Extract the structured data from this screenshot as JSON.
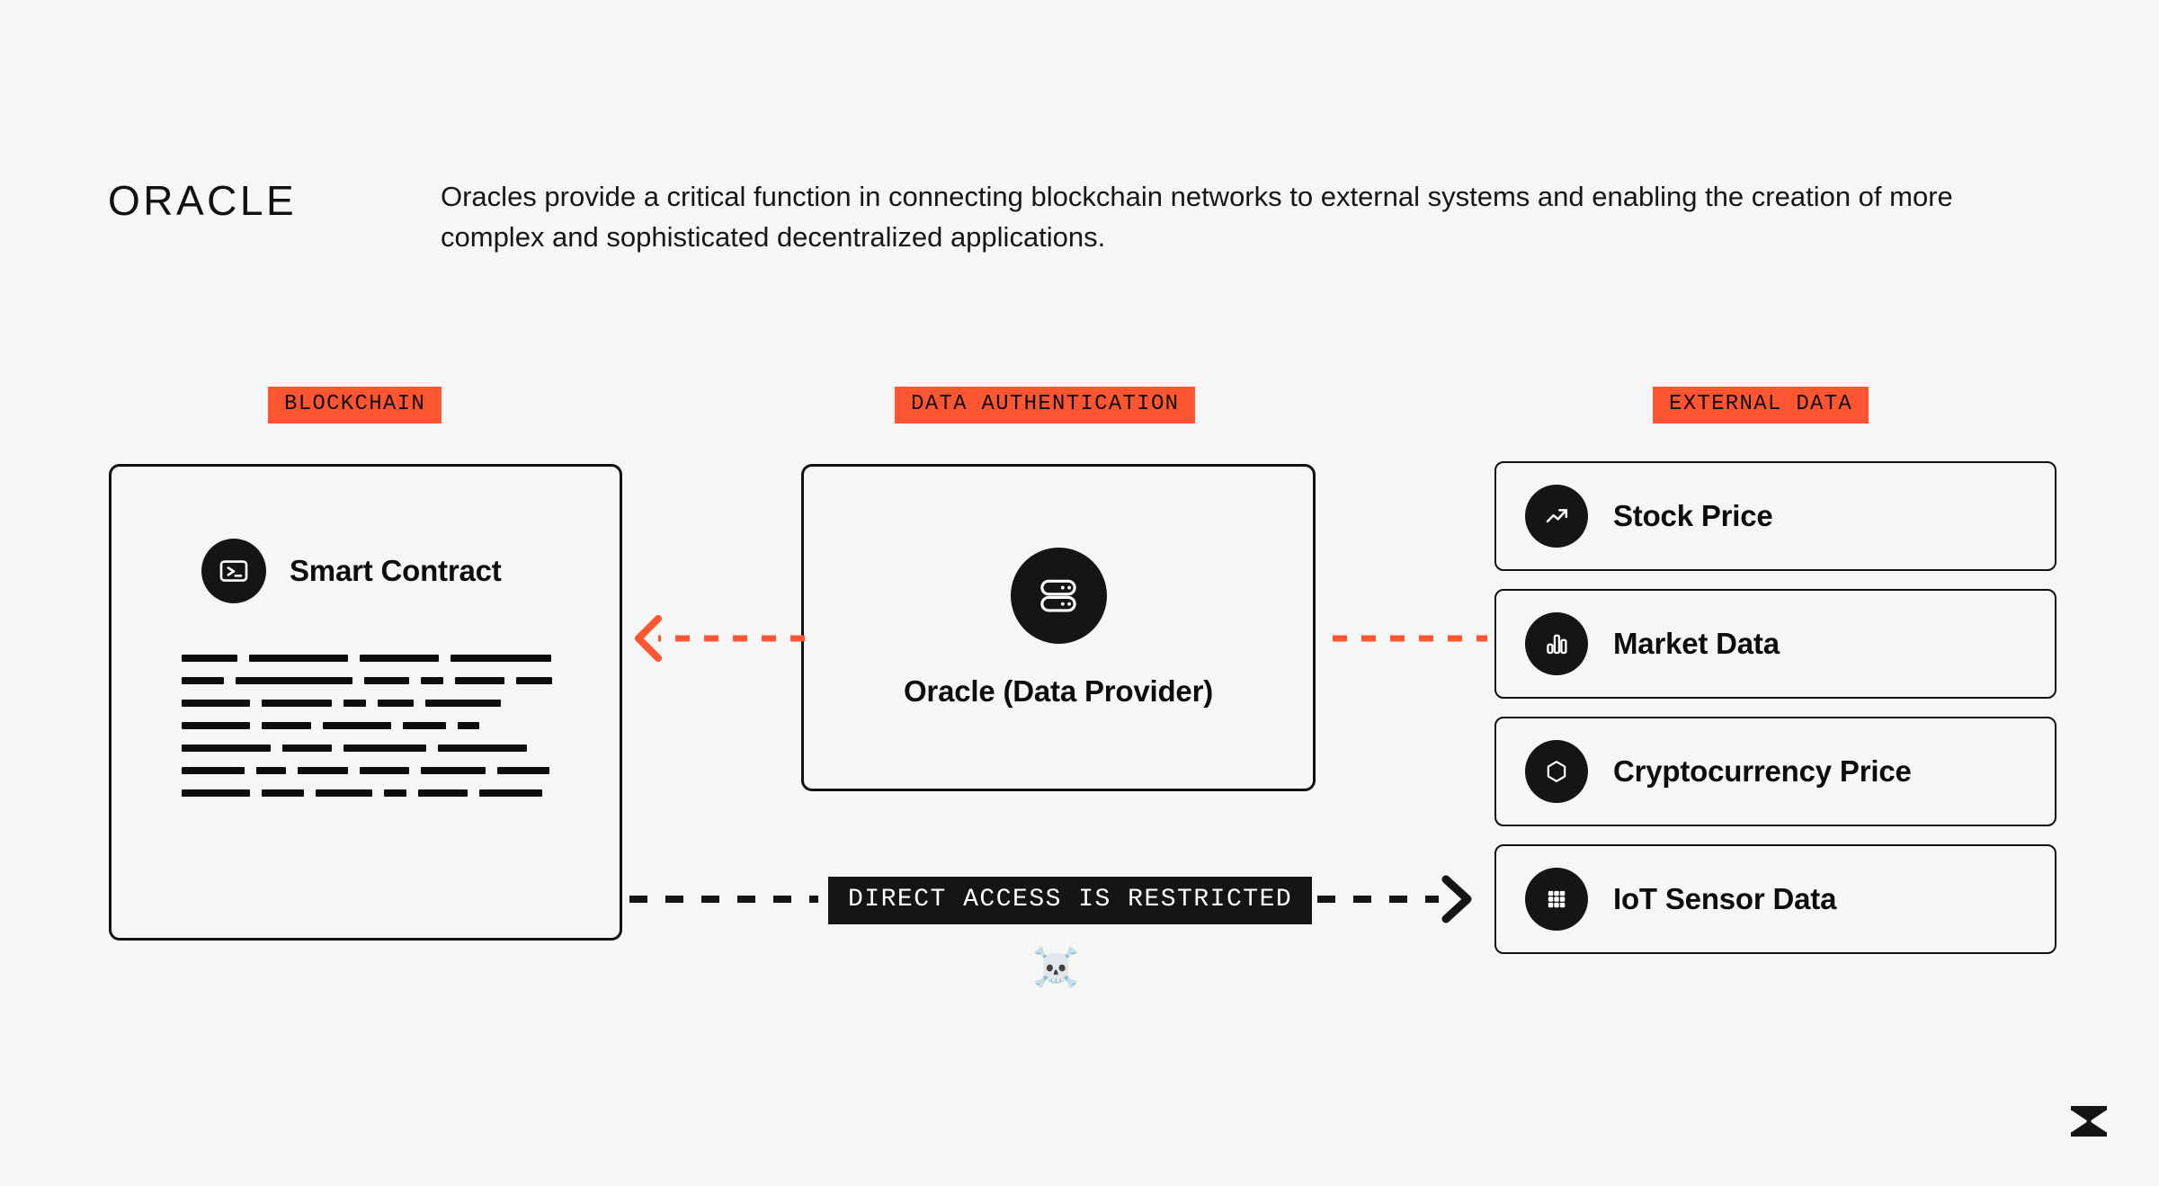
{
  "header": {
    "title": "ORACLE",
    "description": "Oracles provide a critical function in connecting blockchain networks to external systems and enabling the creation of more complex and sophisticated decentralized applications."
  },
  "colors": {
    "accent_orange": "#ff5530",
    "ink": "#111111",
    "background": "#f6f6f6",
    "banner_black": "#151515"
  },
  "columns": {
    "blockchain_tag": "BLOCKCHAIN",
    "data_authentication_tag": "DATA AUTHENTICATION",
    "external_data_tag": "EXTERNAL DATA"
  },
  "blockchain": {
    "node_label": "Smart Contract",
    "node_icon": "terminal-icon",
    "code_rows": [
      [
        62,
        110,
        88,
        112
      ],
      [
        47,
        130,
        50,
        25,
        55,
        40
      ],
      [
        76,
        78,
        25,
        40,
        84
      ],
      [
        76,
        55,
        76,
        48,
        24
      ],
      [
        99,
        55,
        92,
        99
      ],
      [
        70,
        33,
        56,
        55,
        72,
        58
      ],
      [
        76,
        47,
        63,
        25,
        55,
        70
      ]
    ]
  },
  "oracle": {
    "label": "Oracle (Data Provider)",
    "icon": "server-icon"
  },
  "external_data": {
    "items": [
      {
        "label": "Stock Price",
        "icon": "trending-up-icon"
      },
      {
        "label": "Market Data",
        "icon": "bar-chart-icon"
      },
      {
        "label": "Cryptocurrency Price",
        "icon": "hexagon-icon"
      },
      {
        "label": "IoT Sensor Data",
        "icon": "grid-dots-icon"
      }
    ]
  },
  "connectors": {
    "restricted_banner": "DIRECT ACCESS IS RESTRICTED",
    "restricted_marker": "☠️",
    "oracle_to_blockchain_icon": "dashed-arrow-left",
    "external_to_oracle_icon": "dashed-line",
    "blockchain_to_external_icon": "dashed-arrow-right"
  },
  "footer": {
    "logo": "brand-logo"
  }
}
